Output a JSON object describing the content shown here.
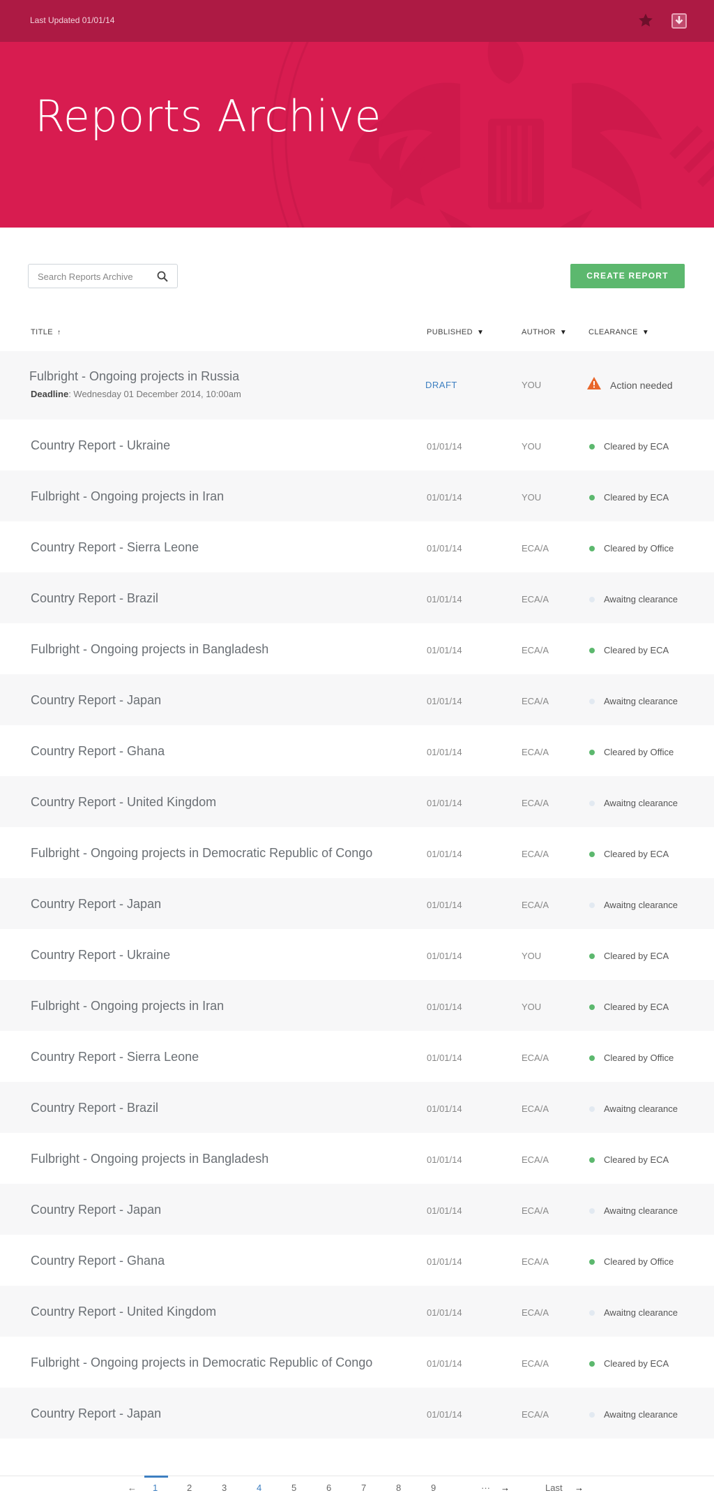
{
  "topbar": {
    "updated": "Last Updated 01/01/14",
    "star_icon": "star-icon",
    "download_icon": "download-icon"
  },
  "hero": {
    "title": "Reports Archive"
  },
  "search": {
    "placeholder": "Search Reports Archive",
    "icon": "search-icon"
  },
  "create_button": "CREATE REPORT",
  "columns": {
    "title": "TITLE",
    "published": "PUBLISHED",
    "author": "AUTHOR",
    "clearance": "CLEARANCE",
    "title_sort": "↑",
    "sort_arrow": "▼"
  },
  "status_colors": {
    "cleared": "#5cb86e",
    "awaiting": "#e2e9f1",
    "warning": "#e8662a",
    "accent": "#d81c50"
  },
  "rows": [
    {
      "title": "Fulbright - Ongoing projects in Russia",
      "deadline_label": "Deadline",
      "deadline": ": Wednesday 01 December 2014, 10:00am",
      "published": "DRAFT",
      "author": "YOU",
      "clearance": "Action needed",
      "status": "warning"
    },
    {
      "title": "Country Report - Ukraine",
      "published": "01/01/14",
      "author": "YOU",
      "clearance": "Cleared by ECA",
      "status": "cleared"
    },
    {
      "title": "Fulbright - Ongoing projects in Iran",
      "published": "01/01/14",
      "author": "YOU",
      "clearance": "Cleared by ECA",
      "status": "cleared"
    },
    {
      "title": "Country Report - Sierra Leone",
      "published": "01/01/14",
      "author": "ECA/A",
      "clearance": "Cleared by Office",
      "status": "cleared"
    },
    {
      "title": "Country Report - Brazil",
      "published": "01/01/14",
      "author": "ECA/A",
      "clearance": "Awaitng clearance",
      "status": "awaiting"
    },
    {
      "title": "Fulbright - Ongoing projects in Bangladesh",
      "published": "01/01/14",
      "author": "ECA/A",
      "clearance": "Cleared by ECA",
      "status": "cleared"
    },
    {
      "title": "Country Report - Japan",
      "published": "01/01/14",
      "author": "ECA/A",
      "clearance": "Awaitng clearance",
      "status": "awaiting"
    },
    {
      "title": "Country Report - Ghana",
      "published": "01/01/14",
      "author": "ECA/A",
      "clearance": "Cleared by Office",
      "status": "cleared"
    },
    {
      "title": "Country Report - United Kingdom",
      "published": "01/01/14",
      "author": "ECA/A",
      "clearance": "Awaitng clearance",
      "status": "awaiting"
    },
    {
      "title": "Fulbright - Ongoing projects in Democratic Republic of Congo",
      "published": "01/01/14",
      "author": "ECA/A",
      "clearance": "Cleared by ECA",
      "status": "cleared"
    },
    {
      "title": "Country Report - Japan",
      "published": "01/01/14",
      "author": "ECA/A",
      "clearance": "Awaitng clearance",
      "status": "awaiting"
    },
    {
      "title": "Country Report - Ukraine",
      "published": "01/01/14",
      "author": "YOU",
      "clearance": "Cleared by ECA",
      "status": "cleared"
    },
    {
      "title": "Fulbright - Ongoing projects in Iran",
      "published": "01/01/14",
      "author": "YOU",
      "clearance": "Cleared by ECA",
      "status": "cleared"
    },
    {
      "title": "Country Report - Sierra Leone",
      "published": "01/01/14",
      "author": "ECA/A",
      "clearance": "Cleared by Office",
      "status": "cleared"
    },
    {
      "title": "Country Report - Brazil",
      "published": "01/01/14",
      "author": "ECA/A",
      "clearance": "Awaitng clearance",
      "status": "awaiting"
    },
    {
      "title": "Fulbright - Ongoing projects in Bangladesh",
      "published": "01/01/14",
      "author": "ECA/A",
      "clearance": "Cleared by ECA",
      "status": "cleared"
    },
    {
      "title": "Country Report - Japan",
      "published": "01/01/14",
      "author": "ECA/A",
      "clearance": "Awaitng clearance",
      "status": "awaiting"
    },
    {
      "title": "Country Report - Ghana",
      "published": "01/01/14",
      "author": "ECA/A",
      "clearance": "Cleared by Office",
      "status": "cleared"
    },
    {
      "title": "Country Report - United Kingdom",
      "published": "01/01/14",
      "author": "ECA/A",
      "clearance": "Awaitng clearance",
      "status": "awaiting"
    },
    {
      "title": "Fulbright - Ongoing projects in Democratic Republic of Congo",
      "published": "01/01/14",
      "author": "ECA/A",
      "clearance": "Cleared by ECA",
      "status": "cleared"
    },
    {
      "title": "Country Report - Japan",
      "published": "01/01/14",
      "author": "ECA/A",
      "clearance": "Awaitng clearance",
      "status": "awaiting"
    }
  ],
  "pager": {
    "prev": "←",
    "pages": [
      "1",
      "2",
      "3",
      "4",
      "5",
      "6",
      "7",
      "8",
      "9"
    ],
    "active_page": "1",
    "highlight_page": "4",
    "ellipsis": "···",
    "next": "→",
    "last": "Last",
    "last_arrow": "→"
  }
}
